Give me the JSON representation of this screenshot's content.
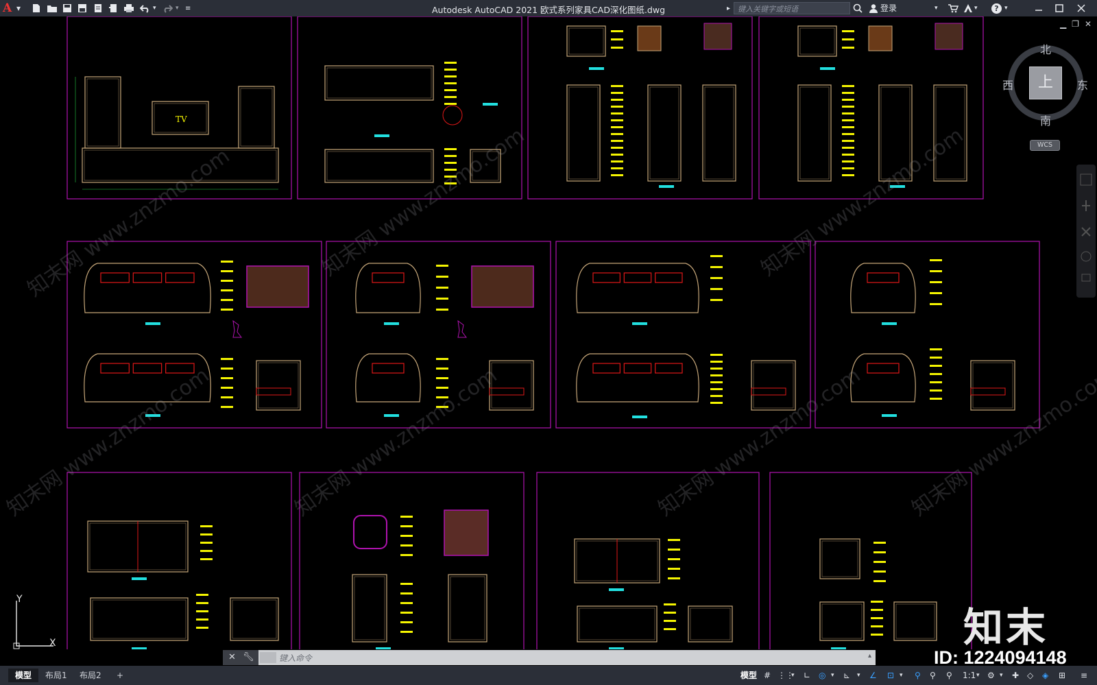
{
  "app": {
    "logo_letter": "A",
    "title": "Autodesk AutoCAD 2021    欧式系列家具CAD深化图纸.dwg",
    "search_placeholder": "键入关键字或短语",
    "login_label": "登录",
    "help_label": "?"
  },
  "viewcube": {
    "north": "北",
    "south": "南",
    "east": "东",
    "west": "西",
    "top_face": "上",
    "wcs_label": "WCS"
  },
  "drawing": {
    "tv_label": "TV",
    "ucs_y_label": "Y",
    "ucs_x_label": "X"
  },
  "command_line": {
    "placeholder": "键入命令"
  },
  "status": {
    "tabs": [
      {
        "label": "模型",
        "active": true
      },
      {
        "label": "布局1",
        "active": false
      },
      {
        "label": "布局2",
        "active": false
      }
    ],
    "add_tab": "+",
    "model_label": "模型",
    "scale_label": "1:1"
  },
  "watermark": {
    "site_cn": "知末网 www.znzmo.com",
    "brand": "知末",
    "id_label": "ID: 1224094148"
  },
  "colors": {
    "sheet_border": "#b013b0",
    "furniture": "#c8a87a",
    "dimension_yellow": "#f5f500",
    "dimension_green": "#22cc44",
    "cushion_red": "#e01818",
    "label_cyan": "#22e0e0"
  }
}
